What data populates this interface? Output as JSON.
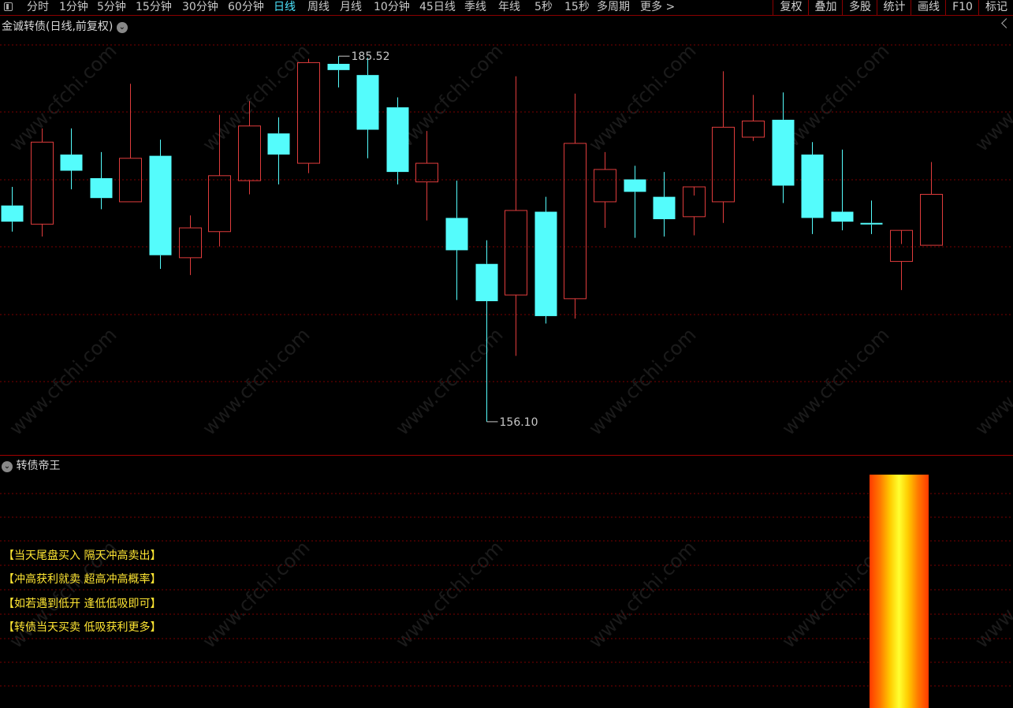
{
  "toolbar": {
    "periods": [
      "分时",
      "1分钟",
      "5分钟",
      "15分钟",
      "30分钟",
      "60分钟",
      "日线",
      "周线",
      "月线",
      "10分钟",
      "45日线",
      "季线",
      "年线",
      "5秒",
      "15秒",
      "多周期",
      "更多 >"
    ],
    "active_period": "日线",
    "right_buttons": [
      "复权",
      "叠加",
      "多股",
      "统计",
      "画线",
      "F10",
      "标记"
    ]
  },
  "main_panel": {
    "title": "金诚转债(日线,前复权)",
    "high_label": "185.52",
    "low_label": "156.10"
  },
  "indicator_panel": {
    "title": "转债帝王",
    "signals": [
      "【当天尾盘买入  隔天冲高卖出】",
      "【冲高获利就卖  超高冲高概率】",
      "【如若遇到低开  逢低低吸即可】",
      "【转债当天买卖  低吸获利更多】"
    ]
  },
  "watermark": "www.cfchi.com",
  "colors": {
    "up": "#e03c3c",
    "down": "#54fcfc",
    "grid": "#7a0000",
    "signal_text": "#ffe633",
    "active_tab": "#4de6ff"
  },
  "chart_data": {
    "type": "candlestick",
    "y_range": [
      154.0,
      187.5
    ],
    "max_marked": 185.52,
    "min_marked": 156.1,
    "candles": [
      {
        "o": 173.5,
        "h": 175.0,
        "l": 171.4,
        "c": 172.2
      },
      {
        "o": 172.0,
        "h": 179.7,
        "l": 171.0,
        "c": 178.6
      },
      {
        "o": 177.6,
        "h": 179.7,
        "l": 174.8,
        "c": 176.3
      },
      {
        "o": 175.7,
        "h": 177.8,
        "l": 173.2,
        "c": 174.1
      },
      {
        "o": 173.8,
        "h": 183.3,
        "l": 173.8,
        "c": 177.3
      },
      {
        "o": 177.5,
        "h": 178.8,
        "l": 168.4,
        "c": 169.5
      },
      {
        "o": 169.3,
        "h": 172.7,
        "l": 167.9,
        "c": 171.7
      },
      {
        "o": 171.4,
        "h": 180.8,
        "l": 170.2,
        "c": 175.9
      },
      {
        "o": 175.5,
        "h": 181.9,
        "l": 174.4,
        "c": 179.9
      },
      {
        "o": 179.3,
        "h": 180.6,
        "l": 175.2,
        "c": 177.6
      },
      {
        "o": 176.9,
        "h": 185.3,
        "l": 176.1,
        "c": 185.0
      },
      {
        "o": 184.9,
        "h": 185.52,
        "l": 183.0,
        "c": 184.4
      },
      {
        "o": 184.0,
        "h": 185.4,
        "l": 177.3,
        "c": 179.6
      },
      {
        "o": 181.4,
        "h": 182.2,
        "l": 175.2,
        "c": 176.2
      },
      {
        "o": 175.4,
        "h": 179.5,
        "l": 172.3,
        "c": 176.9
      },
      {
        "o": 172.5,
        "h": 175.5,
        "l": 165.9,
        "c": 169.9
      },
      {
        "o": 168.8,
        "h": 170.7,
        "l": 156.1,
        "c": 165.8
      },
      {
        "o": 166.3,
        "h": 183.9,
        "l": 161.4,
        "c": 173.1
      },
      {
        "o": 173.0,
        "h": 174.2,
        "l": 164.0,
        "c": 164.6
      },
      {
        "o": 166.0,
        "h": 182.5,
        "l": 164.4,
        "c": 178.5
      },
      {
        "o": 173.8,
        "h": 177.8,
        "l": 171.7,
        "c": 176.4
      },
      {
        "o": 175.6,
        "h": 176.7,
        "l": 170.9,
        "c": 174.6
      },
      {
        "o": 174.2,
        "h": 176.2,
        "l": 171.0,
        "c": 172.4
      },
      {
        "o": 172.6,
        "h": 174.3,
        "l": 171.1,
        "c": 175.0
      },
      {
        "o": 173.8,
        "h": 184.3,
        "l": 172.1,
        "c": 179.8
      },
      {
        "o": 179.0,
        "h": 182.4,
        "l": 178.7,
        "c": 180.3
      },
      {
        "o": 180.4,
        "h": 182.6,
        "l": 173.7,
        "c": 175.1
      },
      {
        "o": 177.6,
        "h": 178.6,
        "l": 171.2,
        "c": 172.5
      },
      {
        "o": 173.0,
        "h": 178.0,
        "l": 171.5,
        "c": 172.2
      },
      {
        "o": 172.1,
        "h": 173.9,
        "l": 171.2,
        "c": 172.0
      },
      {
        "o": 169.0,
        "h": 170.4,
        "l": 166.7,
        "c": 171.5
      },
      {
        "o": 170.3,
        "h": 177.0,
        "l": 170.3,
        "c": 174.4
      }
    ]
  }
}
